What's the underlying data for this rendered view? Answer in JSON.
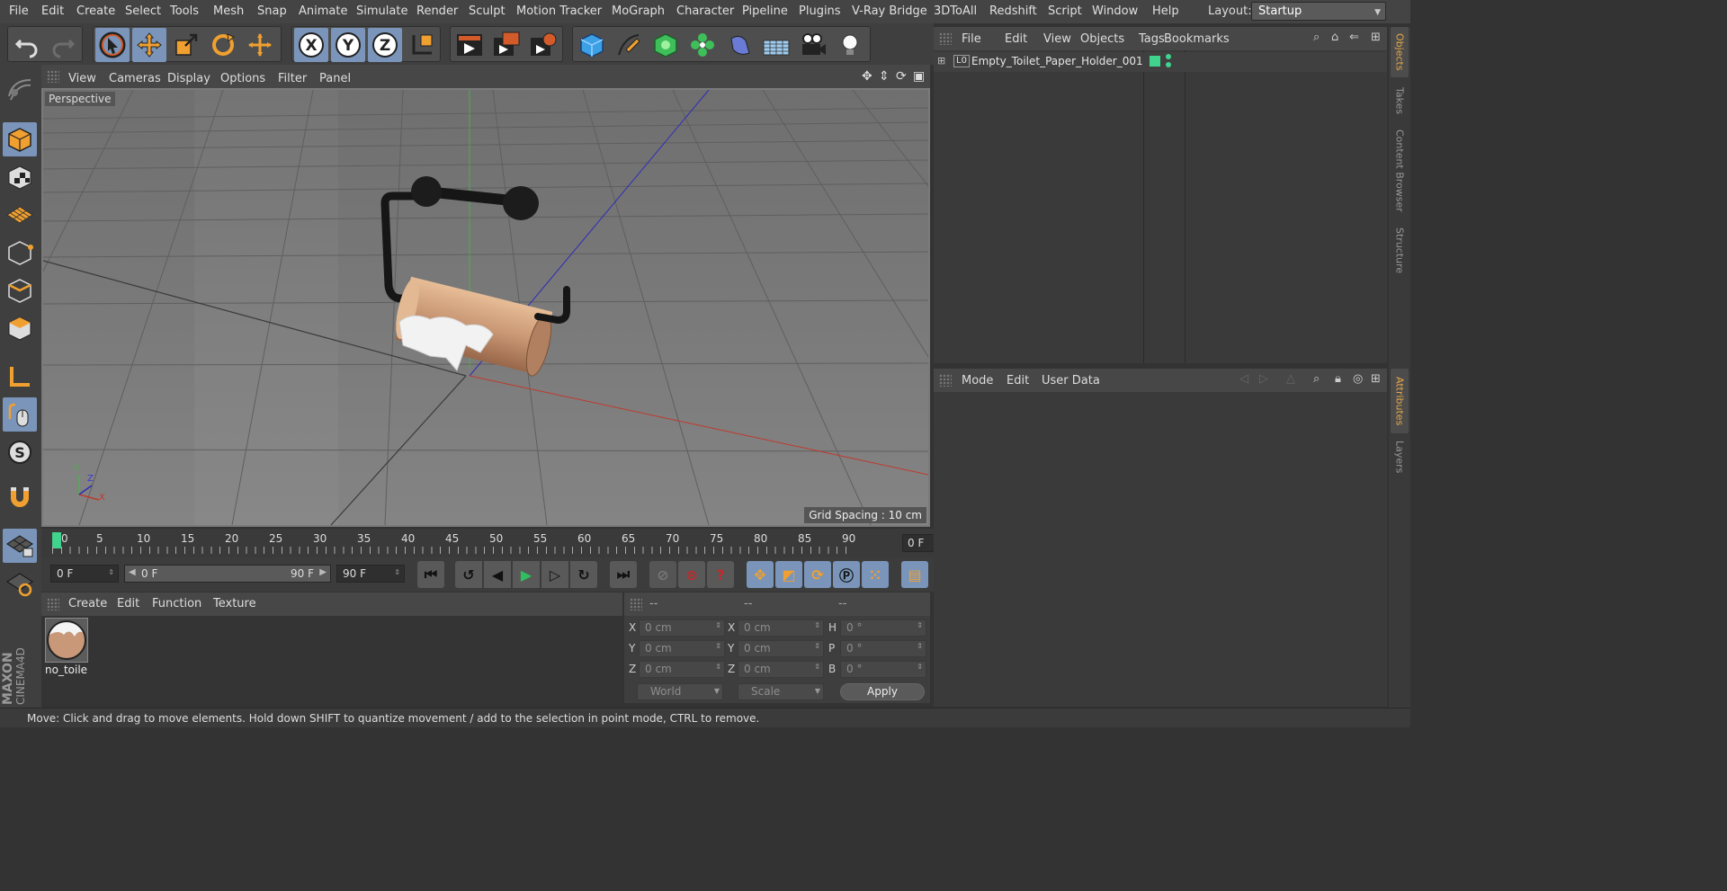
{
  "menubar": {
    "items": [
      "File",
      "Edit",
      "Create",
      "Select",
      "Tools",
      "Mesh",
      "Snap",
      "Animate",
      "Simulate",
      "Render",
      "Sculpt",
      "Motion Tracker",
      "MoGraph",
      "Character",
      "Pipeline",
      "Plugins",
      "V-Ray Bridge",
      "3DToAll",
      "Redshift",
      "Script",
      "Window",
      "Help"
    ],
    "layout_label": "Layout:",
    "layout_value": "Startup"
  },
  "toolbar": {
    "icons": [
      "undo-icon",
      "redo-icon",
      "live-selection-icon",
      "move-icon",
      "scale-icon",
      "rotate-icon",
      "last-tool-icon",
      "x-axis-lock-icon",
      "y-axis-lock-icon",
      "z-axis-lock-icon",
      "coordinate-system-icon",
      "render-view-icon",
      "render-picture-viewer-icon",
      "render-settings-icon",
      "cube-icon",
      "pen-spline-icon",
      "subdivision-icon",
      "cloner-icon",
      "deformer-icon",
      "floor-icon",
      "camera-icon",
      "light-icon"
    ]
  },
  "viewport": {
    "menu": [
      "View",
      "Cameras",
      "Display",
      "Options",
      "Filter",
      "Panel"
    ],
    "camera_label": "Perspective",
    "grid_spacing": "Grid Spacing : 10 cm",
    "axis_labels": {
      "x": "X",
      "y": "Y",
      "z": "Z"
    }
  },
  "timeline": {
    "ticks": [
      "0",
      "5",
      "10",
      "15",
      "20",
      "25",
      "30",
      "35",
      "40",
      "45",
      "50",
      "55",
      "60",
      "65",
      "70",
      "75",
      "80",
      "85",
      "90"
    ],
    "current_frame": "0 F"
  },
  "transport": {
    "start_frame": "0 F",
    "range_start": "0 F",
    "range_end": "90 F",
    "end_frame": "90 F"
  },
  "material_manager": {
    "menu": [
      "Create",
      "Edit",
      "Function",
      "Texture"
    ],
    "material_name": "no_toile"
  },
  "coordinates": {
    "headers": [
      "--",
      "--",
      "--"
    ],
    "rows": [
      {
        "l1": "X",
        "v1": "0 cm",
        "l2": "X",
        "v2": "0 cm",
        "l3": "H",
        "v3": "0 °"
      },
      {
        "l1": "Y",
        "v1": "0 cm",
        "l2": "Y",
        "v2": "0 cm",
        "l3": "P",
        "v3": "0 °"
      },
      {
        "l1": "Z",
        "v1": "0 cm",
        "l2": "Z",
        "v2": "0 cm",
        "l3": "B",
        "v3": "0 °"
      }
    ],
    "mode_select": "World",
    "scale_select": "Scale",
    "apply_label": "Apply"
  },
  "object_manager": {
    "menu": [
      "File",
      "Edit",
      "View",
      "Objects",
      "Tags",
      "Bookmarks"
    ],
    "object_name": "Empty_Toilet_Paper_Holder_001",
    "object_badge": "L0"
  },
  "attribute_manager": {
    "menu": [
      "Mode",
      "Edit",
      "User Data"
    ]
  },
  "right_tabs": {
    "top": [
      "Objects",
      "Takes",
      "Content Browser",
      "Structure"
    ],
    "bottom": [
      "Attributes",
      "Layers"
    ]
  },
  "branding": {
    "line1": "MAXON",
    "line2": "CINEMA4D"
  },
  "status_text": "Move: Click and drag to move elements. Hold down SHIFT to quantize movement / add to the selection in point mode, CTRL to remove.",
  "colors": {
    "accent": "#7a95b9",
    "selection_green": "#3fd38d",
    "highlight_orange": "#e6a847"
  }
}
